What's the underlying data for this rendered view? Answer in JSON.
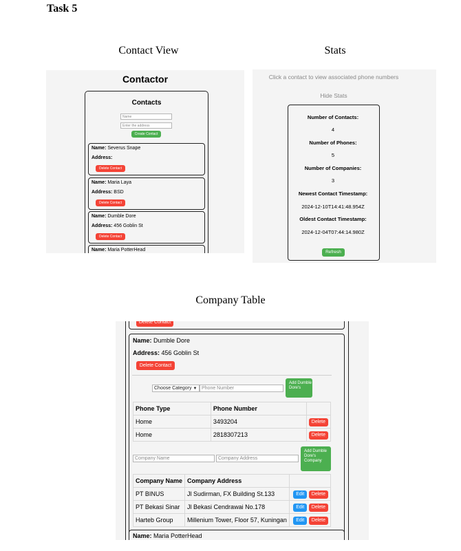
{
  "task_title": "Task 5",
  "captions": {
    "contact_view": "Contact View",
    "stats": "Stats",
    "company_table": "Company Table"
  },
  "contact_view": {
    "app_title": "Contactor",
    "contacts_title": "Contacts",
    "name_placeholder": "Name",
    "address_placeholder": "Enter the address",
    "create_button": "Create Contact",
    "name_label": "Name:",
    "address_label": "Address:",
    "delete_button": "Delete Contact",
    "contacts": [
      {
        "name": "Severus Snape",
        "address": ""
      },
      {
        "name": "Maria Laya",
        "address": "BSD"
      },
      {
        "name": "Dumble Dore",
        "address": "456 Goblin St"
      },
      {
        "name": "Maria PotterHead",
        "address": ""
      }
    ]
  },
  "stats": {
    "hint": "Click a contact to view associated phone numbers",
    "hide_button": "Hide Stats",
    "contacts_label": "Number of Contacts:",
    "contacts_value": "4",
    "phones_label": "Number of Phones:",
    "phones_value": "5",
    "companies_label": "Number of Companies:",
    "companies_value": "3",
    "newest_label": "Newest Contact Timestamp:",
    "newest_value": "2024-12-10T14:41:48.954Z",
    "oldest_label": "Oldest Contact Timestamp:",
    "oldest_value": "2024-12-04T07:44:14.980Z",
    "refresh_button": "Refresh"
  },
  "company_table": {
    "delete_contact_button": "Delete Contact",
    "name_label": "Name:",
    "address_label": "Address:",
    "contact_name": "Dumble Dore",
    "contact_address": "456 Goblin St",
    "category_select": "Choose Category",
    "phone_placeholder": "Phone Number",
    "add_phone_button": "Add Dumble Dore's",
    "phone_headers": [
      "Phone Type",
      "Phone Number"
    ],
    "phones": [
      {
        "type": "Home",
        "number": "3493204"
      },
      {
        "type": "Home",
        "number": "2818307213"
      }
    ],
    "delete_button": "Delete",
    "edit_button": "Edit",
    "company_name_placeholder": "Company Name",
    "company_address_placeholder": "Company Address",
    "add_company_button": "Add Dumble Dore's Company",
    "company_headers": [
      "Company Name",
      "Company Address"
    ],
    "companies": [
      {
        "name": "PT BINUS",
        "address": "Jl Sudirman, FX Building St.133"
      },
      {
        "name": "PT Bekasi Sinar",
        "address": "Jl Bekasi Cendrawai No.178"
      },
      {
        "name": "Harteb Group",
        "address": "Millenium Tower, Floor 57, Kuningan"
      }
    ],
    "next_contact_name": "Maria PotterHead"
  },
  "colors": {
    "green": "#4caf50",
    "red": "#f44336",
    "blue": "#2196f3",
    "panel_bg": "#f4f4f4"
  }
}
